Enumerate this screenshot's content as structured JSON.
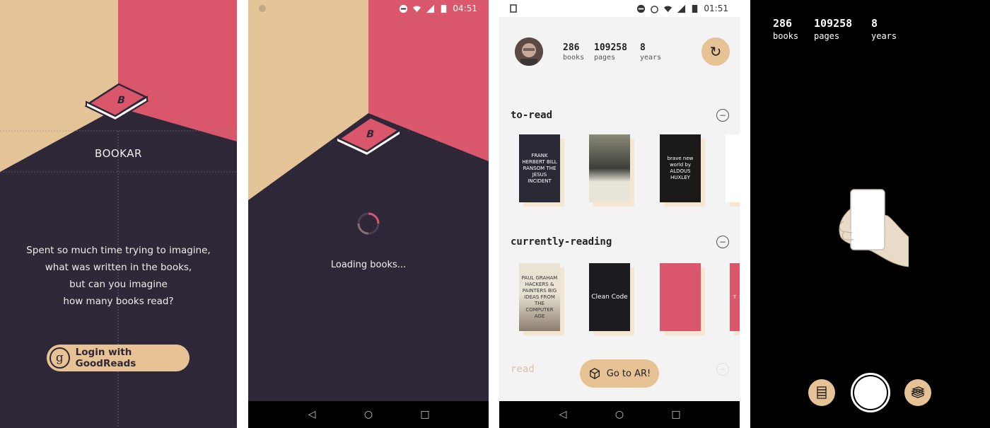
{
  "screen_login": {
    "app_title": "BOOKAR",
    "tagline": [
      "Spent so much time trying to imagine,",
      "what was written in the books,",
      "but can you imagine",
      "how many books read?"
    ],
    "login_button": "Login with GoodReads",
    "login_icon_letter": "g"
  },
  "screen_loading": {
    "status_time": "04:51",
    "loading_text": "Loading books..."
  },
  "screen_library": {
    "status_time": "01:51",
    "stats": {
      "books_value": "286",
      "books_label": "books",
      "pages_value": "109258",
      "pages_label": "pages",
      "years_value": "8",
      "years_label": "years"
    },
    "refresh_icon": "↻",
    "sections": [
      {
        "title": "to-read",
        "books": [
          {
            "title": "FRANK HERBERT BILL RANSOM THE JESUS INCIDENT",
            "color": "#2a2a36"
          },
          {
            "title": "",
            "color": "#3b3f3a"
          },
          {
            "title": "brave new world by ALDOUS HUXLEY",
            "color": "#1b1a18"
          },
          {
            "title": "",
            "color": "#ffffff"
          }
        ]
      },
      {
        "title": "currently-reading",
        "books": [
          {
            "title": "PAUL GRAHAM HACKERS & PAINTERS BIG IDEAS FROM THE COMPUTER AGE",
            "color": "#e9e3d3"
          },
          {
            "title": "Clean Code",
            "color": "#1c1c20"
          },
          {
            "title": "",
            "color": "#d9566b"
          },
          {
            "title": "T",
            "color": "#d9566b"
          }
        ]
      },
      {
        "title": "read",
        "books": []
      }
    ],
    "ar_button": "Go to AR!"
  },
  "screen_ar": {
    "stats": {
      "books_value": "286",
      "books_label": "books",
      "pages_value": "109258",
      "pages_label": "pages",
      "years_value": "8",
      "years_label": "years"
    }
  },
  "colors": {
    "dark_purple": "#2e2738",
    "tan": "#e6c294",
    "pink": "#d9566b",
    "light_bg": "#f4f3f3"
  }
}
